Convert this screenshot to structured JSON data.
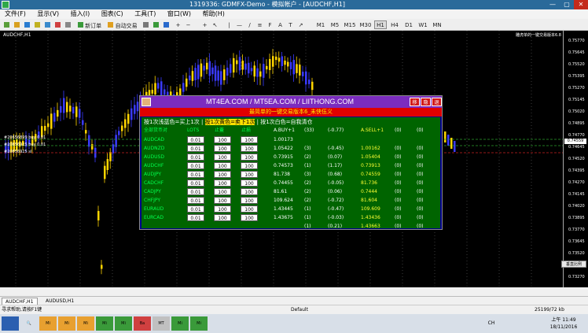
{
  "window": {
    "title": "1319336: GDMFX-Demo - 模拟帐户 - [AUDCHF,H1]",
    "controls": [
      "—",
      "▢",
      "✕"
    ]
  },
  "menu": {
    "items": [
      "文件(F)",
      "显示(V)",
      "插入(I)",
      "图表(C)",
      "工具(T)",
      "窗口(W)",
      "帮助(H)"
    ]
  },
  "toolbar": {
    "new_order_label": "新订单",
    "auto_trade_label": "自动交易",
    "timeframes": [
      "M1",
      "M5",
      "M15",
      "M30",
      "H1",
      "H4",
      "D1",
      "W1",
      "MN"
    ]
  },
  "chart": {
    "symbol_label": "AUDCHF,H1",
    "top_right_label": "雕虎单的一键交易版本6.8 ☺",
    "current_price": "0.74559",
    "y_ticks": [
      "0.75770",
      "0.75645",
      "0.75520",
      "0.75395",
      "0.75270",
      "0.75145",
      "0.75020",
      "0.74895",
      "0.74770",
      "0.74645",
      "0.74520",
      "0.74395",
      "0.74270",
      "0.74145",
      "0.74020",
      "0.73895",
      "0.73770",
      "0.73645",
      "0.73520",
      "0.73395",
      "0.73270"
    ],
    "x_ticks": [
      "10 Nov 2016",
      "11 Nov 02:00",
      "11 Nov 10:00",
      "11 Nov 18:00",
      "14 Nov 02:00",
      "14 Nov 10:00",
      "14 Nov 18:00",
      "15 Nov 02:00",
      "15 Nov 10:00",
      "15 Nov 18:00",
      "16 Nov 02:00",
      "16 Nov 10:00",
      "16 Nov 18:00",
      "17 Nov 02:00",
      "17 Nov 10:00",
      "17 Nov 18:00",
      "18 Nov 02:00"
    ],
    "order_labels": [
      "#20656899 buy 0.01",
      "#20656925 buy 0.01",
      "#20656925 sl"
    ],
    "vertical_scale_button": "垂直比例",
    "colors": {
      "bull": "#3a3aff",
      "bear": "#ffd500",
      "grid": "#666666",
      "level_green": "#2e9e2e",
      "level_red": "#c82020"
    }
  },
  "panel": {
    "title": "MT4EA.COM / MT5EA.COM / LIITHONG.COM",
    "btn_move": "移",
    "btn_hide": "隐",
    "btn_exit": "退",
    "subtitle": "最简单的一键交易版本6_未侠伍义",
    "instr_blue": "按1次浅蓝色=买上1次",
    "instr_sep1": "|",
    "instr_yellow": "按1次黄色=卖下1次",
    "instr_sep2": "|",
    "instr_white": "按1次白色=自我清仓",
    "headers": {
      "symbol": "全部货币对",
      "lots": "LOTS",
      "sl": "止蓋",
      "tp": "止损"
    },
    "rows": [
      {
        "symbol": "AUDCAD",
        "lots": "0.01",
        "sl": "100",
        "tp": "100",
        "buy": "1.00173",
        "buy_count": "(33)",
        "buy_pl": "(-0.77)",
        "sell": "A.SELL+1",
        "sell_count": "(0)",
        "sell_pl": "(0)",
        "buy_label": "A.BUY+1"
      },
      {
        "symbol": "AUDNZD",
        "lots": "0.01",
        "sl": "100",
        "tp": "100",
        "buy": "1.05422",
        "buy_count": "(3)",
        "buy_pl": "(-0.45)",
        "sell": "1.00162",
        "sell_count": "(0)",
        "sell_pl": "(0)"
      },
      {
        "symbol": "AUDUSD",
        "lots": "0.01",
        "sl": "100",
        "tp": "100",
        "buy": "0.73915",
        "buy_count": "(2)",
        "buy_pl": "(0.07)",
        "sell": "1.05404",
        "sell_count": "(0)",
        "sell_pl": "(0)"
      },
      {
        "symbol": "AUDCHF",
        "lots": "0.01",
        "sl": "100",
        "tp": "100",
        "buy": "0.74573",
        "buy_count": "(1)",
        "buy_pl": "(1.17)",
        "sell": "0.73913",
        "sell_count": "(0)",
        "sell_pl": "(0)"
      },
      {
        "symbol": "AUDJPY",
        "lots": "0.01",
        "sl": "100",
        "tp": "100",
        "buy": "81.738",
        "buy_count": "(3)",
        "buy_pl": "(0.68)",
        "sell": "0.74559",
        "sell_count": "(0)",
        "sell_pl": "(0)"
      },
      {
        "symbol": "CADCHF",
        "lots": "0.01",
        "sl": "100",
        "tp": "100",
        "buy": "0.74455",
        "buy_count": "(2)",
        "buy_pl": "(-0.05)",
        "sell": "81.736",
        "sell_count": "(0)",
        "sell_pl": "(0)"
      },
      {
        "symbol": "CADJPY",
        "lots": "0.01",
        "sl": "100",
        "tp": "100",
        "buy": "81.61",
        "buy_count": "(2)",
        "buy_pl": "(0.06)",
        "sell": "0.7444",
        "sell_count": "(0)",
        "sell_pl": "(0)"
      },
      {
        "symbol": "CHFJPY",
        "lots": "0.01",
        "sl": "100",
        "tp": "100",
        "buy": "109.624",
        "buy_count": "(2)",
        "buy_pl": "(-0.72)",
        "sell": "81.604",
        "sell_count": "(0)",
        "sell_pl": "(0)"
      },
      {
        "symbol": "EURAUD",
        "lots": "0.01",
        "sl": "100",
        "tp": "100",
        "buy": "1.43445",
        "buy_count": "(1)",
        "buy_pl": "(-0.47)",
        "sell": "109.609",
        "sell_count": "(0)",
        "sell_pl": "(0)"
      },
      {
        "symbol": "EURCAD",
        "lots": "0.01",
        "sl": "100",
        "tp": "100",
        "buy": "1.43675",
        "buy_count": "(1)",
        "buy_pl": "(-0.03)",
        "sell": "1.43436",
        "sell_count": "(0)",
        "sell_pl": "(0)"
      }
    ],
    "extra_row": {
      "buy_count": "(1)",
      "buy_pl": "(0.21)",
      "sell": "1.43663",
      "sell_count": "(0)",
      "sell_pl": "(0)"
    }
  },
  "tabs": [
    "AUDCHF,H1",
    "AUDUSD,H1"
  ],
  "status": {
    "help": "寻求帮助,请按F1键",
    "profile": "Default",
    "traffic": "25199/72 kb"
  },
  "taskbar": {
    "time": "上午 11:49",
    "date": "18/11/2016",
    "lang": "CH",
    "items": [
      "Mi",
      "Mi",
      "Mi",
      "Mi",
      "Mi",
      "Ba",
      "MT",
      "Mi",
      "Mi"
    ]
  }
}
